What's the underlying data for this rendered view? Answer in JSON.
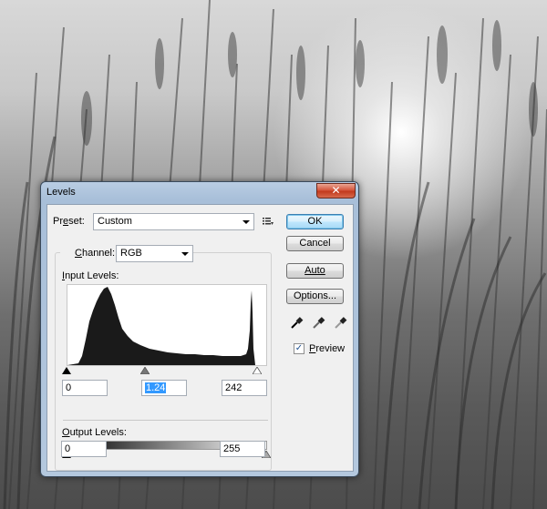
{
  "dialog": {
    "title": "Levels",
    "close_label": "✕"
  },
  "preset": {
    "label_prefix": "Pr",
    "label_mnemonic": "e",
    "label_suffix": "set:",
    "value": "Custom",
    "menu_icon": "preset-options-icon"
  },
  "channel": {
    "label_mnemonic": "C",
    "label_suffix": "hannel:",
    "value": "RGB"
  },
  "input_levels": {
    "label_mnemonic": "I",
    "label_suffix": "nput Levels:",
    "black": "0",
    "gamma": "1.24",
    "white": "242",
    "black_fraction": 0.0,
    "gamma_fraction": 0.39,
    "white_fraction": 0.95
  },
  "output_levels": {
    "label_mnemonic": "O",
    "label_suffix": "utput Levels:",
    "black": "0",
    "white": "255"
  },
  "buttons": {
    "ok": "OK",
    "cancel": "Cancel",
    "auto": "Auto",
    "options": "Options..."
  },
  "eyedroppers": [
    "black-point-eyedropper-icon",
    "gray-point-eyedropper-icon",
    "white-point-eyedropper-icon"
  ],
  "preview": {
    "checked": true,
    "label_mnemonic": "P",
    "label_suffix": "review"
  },
  "colors": {
    "accent": "#3399ff",
    "histogram": "#1a1a1a"
  }
}
